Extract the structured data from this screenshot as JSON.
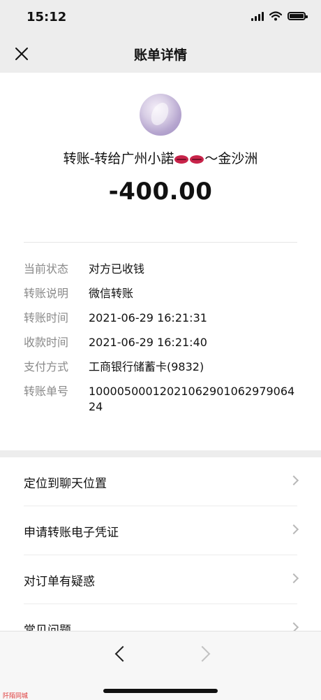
{
  "status_bar": {
    "time": "15:12",
    "icons": [
      "signal-icon",
      "wifi-icon",
      "battery-icon"
    ]
  },
  "nav": {
    "title": "账单详情",
    "close_icon": "close-icon"
  },
  "transaction": {
    "payee_prefix": "转账-转给广州小諾",
    "payee_suffix": "～金沙洲",
    "payee_emoji": "kiss-mark-icon",
    "amount": "-400.00"
  },
  "details": [
    {
      "label": "当前状态",
      "value": "对方已收钱"
    },
    {
      "label": "转账说明",
      "value": "微信转账"
    },
    {
      "label": "转账时间",
      "value": "2021-06-29 16:21:31"
    },
    {
      "label": "收款时间",
      "value": "2021-06-29 16:21:40"
    },
    {
      "label": "支付方式",
      "value": "工商银行储蓄卡(9832)"
    },
    {
      "label": "转账单号",
      "value": "100005000120210629010629790642​4"
    }
  ],
  "menu": [
    {
      "label": "定位到聊天位置"
    },
    {
      "label": "申请转账电子凭证"
    },
    {
      "label": "对订单有疑惑"
    },
    {
      "label": "常见问题"
    }
  ],
  "bottom_nav": {
    "back_icon": "back-arrow-icon",
    "forward_icon": "forward-arrow-icon"
  },
  "watermark": "阡陌同城",
  "colors": {
    "background": "#ededed",
    "card": "#ffffff",
    "label_gray": "#8a8a8a",
    "emoji_red": "#c8244a"
  }
}
